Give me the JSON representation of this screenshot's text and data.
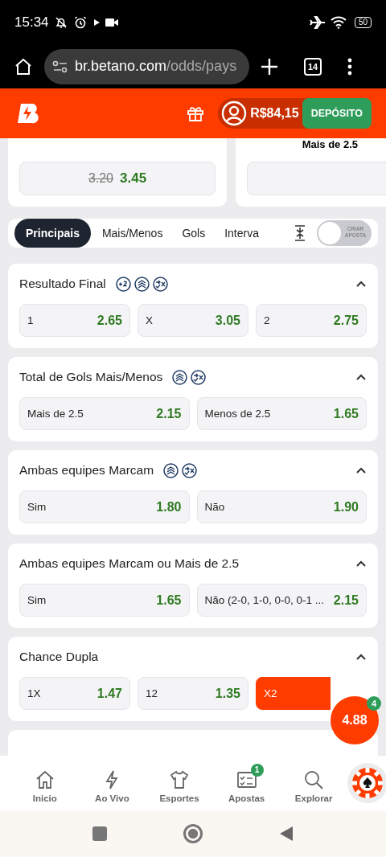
{
  "status_bar": {
    "time": "15:34",
    "battery": "50"
  },
  "browser": {
    "url_host": "br.betano.com",
    "url_path": "/odds/pays",
    "tab_count": "14"
  },
  "header": {
    "balance": "R$84,15",
    "deposit_button": "DEPÓSITO"
  },
  "top_cards": [
    {
      "old_odd": "3.20",
      "odd": "3.45"
    },
    {
      "label": "Mais de 2.5"
    }
  ],
  "tabs": [
    {
      "label": "Principais",
      "selected": true
    },
    {
      "label": "Mais/Menos",
      "selected": false
    },
    {
      "label": "Gols",
      "selected": false
    },
    {
      "label": "Interva",
      "selected": false
    }
  ],
  "create_bet_toggle": {
    "label": "CRIAR APOSTA",
    "on": false
  },
  "markets": [
    {
      "title": "Resultado Final",
      "icons": [
        {
          "kind": "plus2"
        },
        {
          "kind": "layers"
        },
        {
          "kind": "swap"
        }
      ],
      "expanded": true,
      "outcomes": [
        {
          "label": "1",
          "odd": "2.65",
          "selected": false
        },
        {
          "label": "X",
          "odd": "3.05",
          "selected": false
        },
        {
          "label": "2",
          "odd": "2.75",
          "selected": false
        }
      ]
    },
    {
      "title": "Total de Gols Mais/Menos",
      "icons": [
        {
          "kind": "layers"
        },
        {
          "kind": "swap"
        }
      ],
      "expanded": true,
      "outcomes": [
        {
          "label": "Mais de 2.5",
          "odd": "2.15",
          "selected": false
        },
        {
          "label": "Menos de 2.5",
          "odd": "1.65",
          "selected": false
        }
      ]
    },
    {
      "title": "Ambas equipes Marcam",
      "icons": [
        {
          "kind": "layers"
        },
        {
          "kind": "swap"
        }
      ],
      "expanded": true,
      "outcomes": [
        {
          "label": "Sim",
          "odd": "1.80",
          "selected": false
        },
        {
          "label": "Não",
          "odd": "1.90",
          "selected": false
        }
      ]
    },
    {
      "title": "Ambas equipes Marcam ou Mais de 2.5",
      "expanded": true,
      "outcomes": [
        {
          "label": "Sim",
          "odd": "1.65",
          "selected": false
        },
        {
          "label": "Não (2-0, 1-0, 0-0, 0-1 ...",
          "odd": "2.15",
          "selected": false
        }
      ]
    },
    {
      "title": "Chance Dupla",
      "expanded": true,
      "outcomes": [
        {
          "label": "1X",
          "odd": "1.47",
          "selected": false
        },
        {
          "label": "12",
          "odd": "1.35",
          "selected": false
        },
        {
          "label": "X2",
          "selected": true
        }
      ]
    }
  ],
  "betslip": {
    "total": "4.88",
    "count": "4"
  },
  "bottom_nav": [
    {
      "label": "Inicio"
    },
    {
      "label": "Ao Vivo"
    },
    {
      "label": "Esportes"
    },
    {
      "label": "Apostas",
      "badge": "1"
    },
    {
      "label": "Explorar"
    }
  ]
}
